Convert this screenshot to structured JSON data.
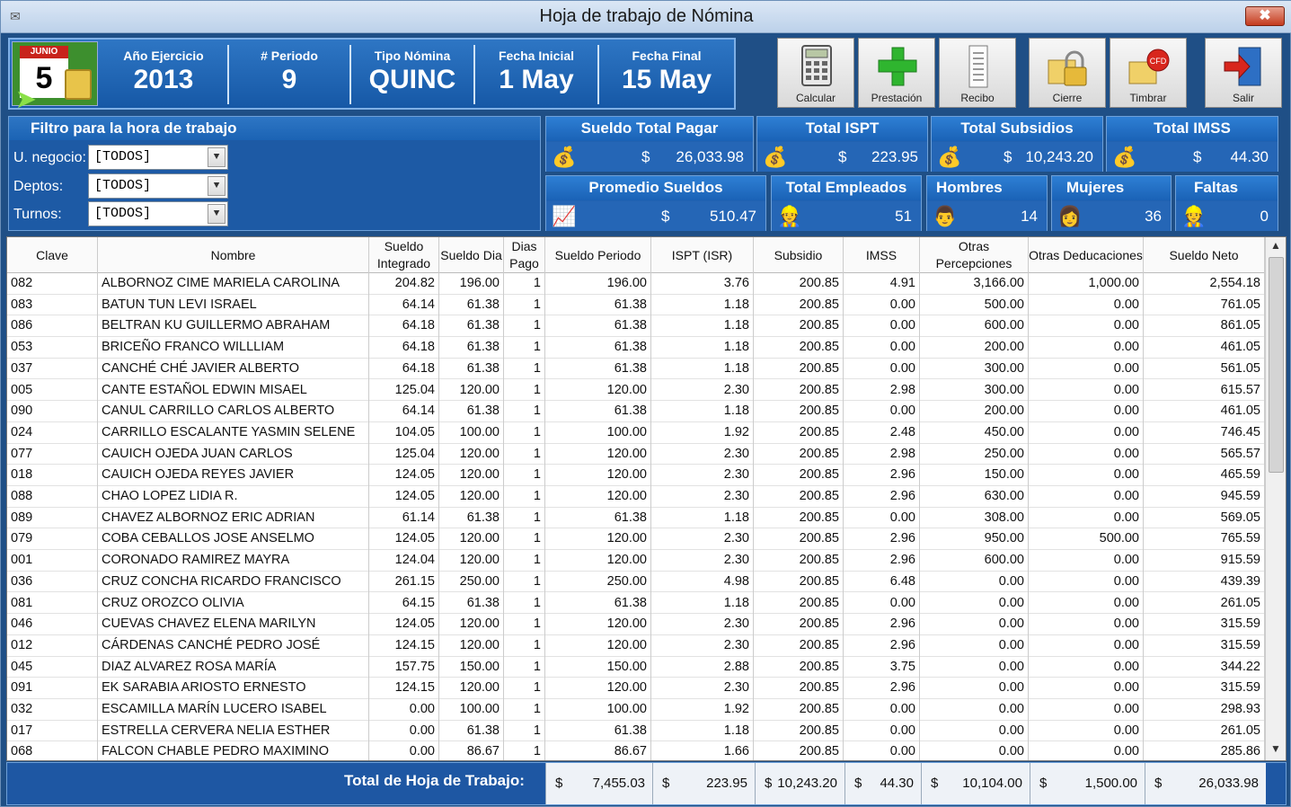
{
  "window": {
    "title": "Hoja de trabajo de Nómina"
  },
  "header": {
    "calendar_month": "JUNIO",
    "calendar_day": "5",
    "fields": [
      {
        "label": "Año Ejercicio",
        "value": "2013"
      },
      {
        "label": "# Periodo",
        "value": "9"
      },
      {
        "label": "Tipo Nómina",
        "value": "QUINC"
      },
      {
        "label": "Fecha Inicial",
        "value": "1 May"
      },
      {
        "label": "Fecha Final",
        "value": "15 May"
      }
    ]
  },
  "toolbar": {
    "calcular": "Calcular",
    "prestacion": "Prestación",
    "recibo": "Recibo",
    "cierre": "Cierre",
    "timbrar": "Timbrar",
    "salir": "Salir",
    "cfd_badge": "CFD"
  },
  "filter": {
    "title": "Filtro para la hora de trabajo",
    "negocio_label": "U. negocio:",
    "negocio_value": "[TODOS]",
    "deptos_label": "Deptos:",
    "deptos_value": "[TODOS]",
    "turnos_label": "Turnos:",
    "turnos_value": "[TODOS]"
  },
  "summary": {
    "sueldo_total": {
      "title": "Sueldo Total Pagar",
      "currency": "$",
      "value": "26,033.98"
    },
    "total_ispt": {
      "title": "Total ISPT",
      "currency": "$",
      "value": "223.95"
    },
    "total_subsidios": {
      "title": "Total Subsidios",
      "currency": "$",
      "value": "10,243.20"
    },
    "total_imss": {
      "title": "Total IMSS",
      "currency": "$",
      "value": "44.30"
    },
    "promedio": {
      "title": "Promedio Sueldos",
      "currency": "$",
      "value": "510.47"
    },
    "empleados": {
      "title": "Total Empleados",
      "value": "51"
    },
    "hombres": {
      "title": "Hombres",
      "value": "14"
    },
    "mujeres": {
      "title": "Mujeres",
      "value": "36"
    },
    "faltas": {
      "title": "Faltas",
      "value": "0"
    }
  },
  "grid": {
    "columns": [
      "Clave",
      "Nombre",
      "Sueldo Integrado",
      "Sueldo Dia",
      "Dias Pago",
      "Sueldo Periodo",
      "ISPT (ISR)",
      "Subsidio",
      "IMSS",
      "Otras Percepciones",
      "Otras Deducaciones",
      "Sueldo Neto"
    ],
    "rows": [
      [
        "082",
        "ALBORNOZ CIME MARIELA CAROLINA",
        "204.82",
        "196.00",
        "1",
        "196.00",
        "3.76",
        "200.85",
        "4.91",
        "3,166.00",
        "1,000.00",
        "2,554.18"
      ],
      [
        "083",
        "BATUN TUN LEVI ISRAEL",
        "64.14",
        "61.38",
        "1",
        "61.38",
        "1.18",
        "200.85",
        "0.00",
        "500.00",
        "0.00",
        "761.05"
      ],
      [
        "086",
        "BELTRAN KU GUILLERMO ABRAHAM",
        "64.18",
        "61.38",
        "1",
        "61.38",
        "1.18",
        "200.85",
        "0.00",
        "600.00",
        "0.00",
        "861.05"
      ],
      [
        "053",
        "BRICEÑO FRANCO WILLLIAM",
        "64.18",
        "61.38",
        "1",
        "61.38",
        "1.18",
        "200.85",
        "0.00",
        "200.00",
        "0.00",
        "461.05"
      ],
      [
        "037",
        "CANCHÉ CHÉ JAVIER ALBERTO",
        "64.18",
        "61.38",
        "1",
        "61.38",
        "1.18",
        "200.85",
        "0.00",
        "300.00",
        "0.00",
        "561.05"
      ],
      [
        "005",
        "CANTE ESTAÑOL EDWIN MISAEL",
        "125.04",
        "120.00",
        "1",
        "120.00",
        "2.30",
        "200.85",
        "2.98",
        "300.00",
        "0.00",
        "615.57"
      ],
      [
        "090",
        "CANUL CARRILLO CARLOS ALBERTO",
        "64.14",
        "61.38",
        "1",
        "61.38",
        "1.18",
        "200.85",
        "0.00",
        "200.00",
        "0.00",
        "461.05"
      ],
      [
        "024",
        "CARRILLO ESCALANTE YASMIN SELENE",
        "104.05",
        "100.00",
        "1",
        "100.00",
        "1.92",
        "200.85",
        "2.48",
        "450.00",
        "0.00",
        "746.45"
      ],
      [
        "077",
        "CAUICH OJEDA JUAN CARLOS",
        "125.04",
        "120.00",
        "1",
        "120.00",
        "2.30",
        "200.85",
        "2.98",
        "250.00",
        "0.00",
        "565.57"
      ],
      [
        "018",
        "CAUICH OJEDA REYES JAVIER",
        "124.05",
        "120.00",
        "1",
        "120.00",
        "2.30",
        "200.85",
        "2.96",
        "150.00",
        "0.00",
        "465.59"
      ],
      [
        "088",
        "CHAO LOPEZ LIDIA R.",
        "124.05",
        "120.00",
        "1",
        "120.00",
        "2.30",
        "200.85",
        "2.96",
        "630.00",
        "0.00",
        "945.59"
      ],
      [
        "089",
        "CHAVEZ ALBORNOZ ERIC ADRIAN",
        "61.14",
        "61.38",
        "1",
        "61.38",
        "1.18",
        "200.85",
        "0.00",
        "308.00",
        "0.00",
        "569.05"
      ],
      [
        "079",
        "COBA CEBALLOS JOSE ANSELMO",
        "124.05",
        "120.00",
        "1",
        "120.00",
        "2.30",
        "200.85",
        "2.96",
        "950.00",
        "500.00",
        "765.59"
      ],
      [
        "001",
        "CORONADO RAMIREZ MAYRA",
        "124.04",
        "120.00",
        "1",
        "120.00",
        "2.30",
        "200.85",
        "2.96",
        "600.00",
        "0.00",
        "915.59"
      ],
      [
        "036",
        "CRUZ CONCHA RICARDO FRANCISCO",
        "261.15",
        "250.00",
        "1",
        "250.00",
        "4.98",
        "200.85",
        "6.48",
        "0.00",
        "0.00",
        "439.39"
      ],
      [
        "081",
        "CRUZ OROZCO OLIVIA",
        "64.15",
        "61.38",
        "1",
        "61.38",
        "1.18",
        "200.85",
        "0.00",
        "0.00",
        "0.00",
        "261.05"
      ],
      [
        "046",
        "CUEVAS CHAVEZ ELENA MARILYN",
        "124.05",
        "120.00",
        "1",
        "120.00",
        "2.30",
        "200.85",
        "2.96",
        "0.00",
        "0.00",
        "315.59"
      ],
      [
        "012",
        "CÁRDENAS CANCHÉ PEDRO JOSÉ",
        "124.15",
        "120.00",
        "1",
        "120.00",
        "2.30",
        "200.85",
        "2.96",
        "0.00",
        "0.00",
        "315.59"
      ],
      [
        "045",
        "DIAZ ALVAREZ ROSA MARÍA",
        "157.75",
        "150.00",
        "1",
        "150.00",
        "2.88",
        "200.85",
        "3.75",
        "0.00",
        "0.00",
        "344.22"
      ],
      [
        "091",
        "EK SARABIA ARIOSTO ERNESTO",
        "124.15",
        "120.00",
        "1",
        "120.00",
        "2.30",
        "200.85",
        "2.96",
        "0.00",
        "0.00",
        "315.59"
      ],
      [
        "032",
        "ESCAMILLA MARÍN LUCERO ISABEL",
        "0.00",
        "100.00",
        "1",
        "100.00",
        "1.92",
        "200.85",
        "0.00",
        "0.00",
        "0.00",
        "298.93"
      ],
      [
        "017",
        "ESTRELLA CERVERA NELIA ESTHER",
        "0.00",
        "61.38",
        "1",
        "61.38",
        "1.18",
        "200.85",
        "0.00",
        "0.00",
        "0.00",
        "261.05"
      ],
      [
        "068",
        "FALCON CHABLE PEDRO MAXIMINO",
        "0.00",
        "86.67",
        "1",
        "86.67",
        "1.66",
        "200.85",
        "0.00",
        "0.00",
        "0.00",
        "285.86"
      ]
    ]
  },
  "footer": {
    "label": "Total de Hoja de Trabajo:",
    "totals": [
      {
        "currency": "$",
        "value": "7,455.03"
      },
      {
        "currency": "$",
        "value": "223.95"
      },
      {
        "currency": "$",
        "value": "10,243.20"
      },
      {
        "currency": "$",
        "value": "44.30"
      },
      {
        "currency": "$",
        "value": "10,104.00"
      },
      {
        "currency": "$",
        "value": "1,500.00"
      },
      {
        "currency": "$",
        "value": "26,033.98"
      }
    ]
  }
}
